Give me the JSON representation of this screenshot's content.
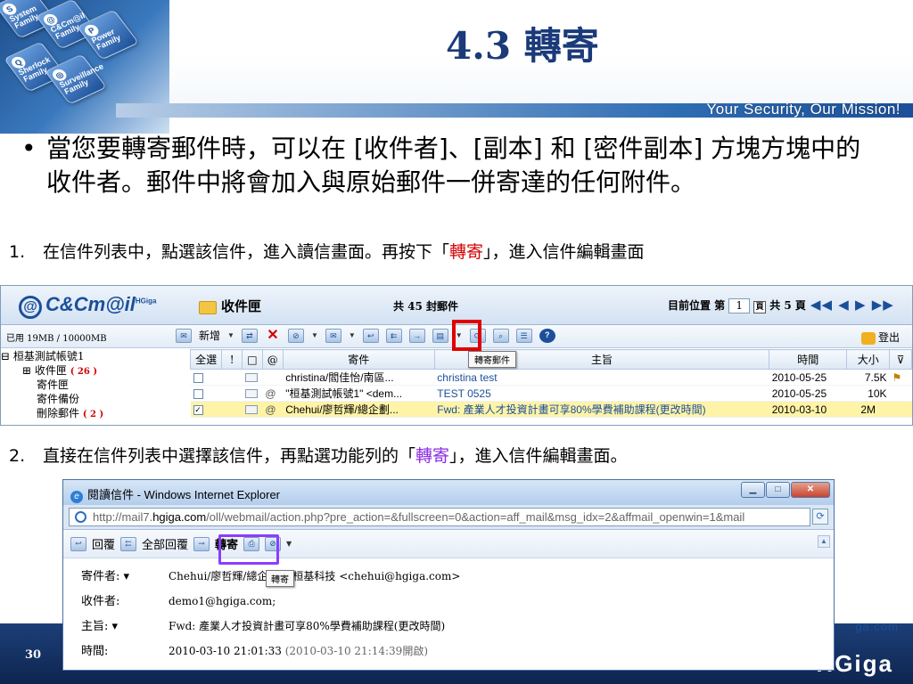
{
  "slide": {
    "title": "4.3 轉寄",
    "motto": "Your Security, Our Mission!",
    "tiles": [
      "System Family",
      "C&Cm@il Family",
      "Power Family",
      "Sherlock Family",
      "Surveillance Family"
    ],
    "bullet": "當您要轉寄郵件時，可以在 [收件者]、[副本] 和 [密件副本] 方塊方塊中的收件者。郵件中將會加入與原始郵件一併寄達的任何附件。",
    "step1": {
      "num": "1.",
      "pre": "在信件列表中，點選該信件，進入讀信畫面。再按下「",
      "key": "轉寄",
      "post": "」，進入信件編輯畫面"
    },
    "step2": {
      "num": "2.",
      "pre": "直接在信件列表中選擇該信件，再點選功能列的「",
      "key": "轉寄",
      "post": "」，進入信件編輯畫面。"
    },
    "page_number": "30",
    "site_fragment": "ga.com",
    "brand": "HGiga"
  },
  "webmail": {
    "logo": "C&Cm@il",
    "logo_sup": "HGiga",
    "folder_title": "收件匣",
    "mail_count": "共 45 封郵件",
    "position_label": "目前位置 第",
    "page_value": "1",
    "go_label": "頁",
    "total_pages": "共 5 頁",
    "nav_arrows": "◀◀ ◀ ▶ ▶▶",
    "usage": "已用 19MB / 10000MB",
    "new_label": "新增",
    "tooltip": "轉寄郵件",
    "logout": "登出",
    "tree": [
      {
        "label": "桓基測試帳號1",
        "count": ""
      },
      {
        "label": "收件匣",
        "count": "( 26 )"
      },
      {
        "label": "寄件匣",
        "count": ""
      },
      {
        "label": "寄件備份",
        "count": ""
      },
      {
        "label": "刪除郵件",
        "count": "( 2 )"
      }
    ],
    "columns": [
      "全選",
      "!",
      "",
      "",
      "寄件",
      "主旨",
      "時間",
      "大小",
      ""
    ],
    "rows": [
      {
        "sender": "christina/閻佳怡/南區...",
        "subject": "christina test",
        "date": "2010-05-25",
        "size": "7.5K",
        "clip": "",
        "checked": ""
      },
      {
        "sender": "\"桓基測試帳號1\" <dem...",
        "subject": "TEST 0525",
        "date": "2010-05-25",
        "size": "10K",
        "clip": "@",
        "checked": ""
      },
      {
        "sender": "Chehui/廖哲輝/總企劃...",
        "subject": "Fwd: 產業人才投資計畫可享80%學費補助課程(更改時間)",
        "date": "2010-03-10",
        "size": "2M",
        "clip": "@",
        "checked": "✓"
      }
    ]
  },
  "ie": {
    "title": "閱讀信件 - Windows Internet Explorer",
    "url_pre": "http://mail7.",
    "url_host": "hgiga.com",
    "url_post": "/oll/webmail/action.php?pre_action=&fullscreen=0&action=aff_mail&msg_idx=2&affmail_openwin=1&mail",
    "reply": "回覆",
    "reply_all": "全部回覆",
    "forward": "轉寄",
    "tooltip": "轉寄",
    "fields": [
      {
        "label": "寄件者:",
        "value": "Chehui/廖哲輝/總企劃處/桓基科技 <chehui@hgiga.com>",
        "extra": ""
      },
      {
        "label": "收件者:",
        "value": "demo1@hgiga.com;",
        "extra": ""
      },
      {
        "label": "主旨:",
        "value": "Fwd: 產業人才投資計畫可享80%學費補助課程(更改時間)",
        "extra": ""
      },
      {
        "label": "時間:",
        "value": "2010-03-10 21:01:33",
        "extra": "(2010-03-10 21:14:39開啟)"
      }
    ]
  }
}
